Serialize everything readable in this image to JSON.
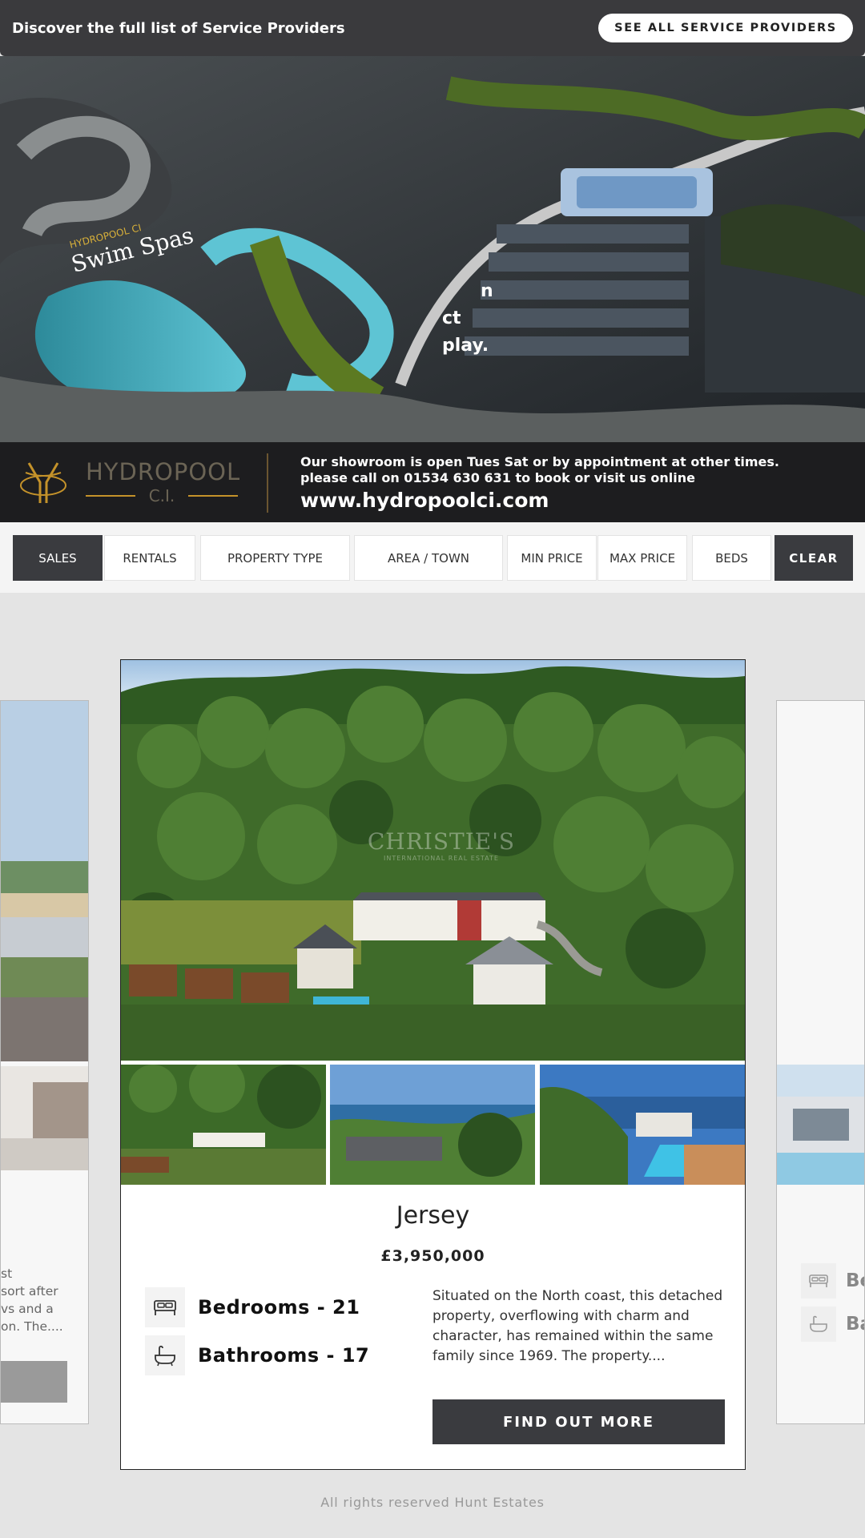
{
  "topbar": {
    "text": "Discover the full list of Service Providers",
    "button": "SEE ALL SERVICE PROVIDERS"
  },
  "ad": {
    "overlay_brand_small": "HYDROPOOL CI",
    "overlay_brand": "Swim Spas",
    "overlay_partial": [
      "n",
      "ct",
      "play."
    ],
    "brand": "HYDROPOOL",
    "brand_sub": "C.I.",
    "info_line1": "Our showroom is open Tues Sat or by appointment at other times.",
    "info_line2": "please call on 01534 630 631 to book or visit us online",
    "url": "www.hydropoolci.com",
    "accent_color": "#c4922a"
  },
  "filters": {
    "items": [
      {
        "label": "SALES"
      },
      {
        "label": "RENTALS"
      },
      {
        "label": "PROPERTY TYPE"
      },
      {
        "label": "AREA / TOWN"
      },
      {
        "label": "MIN PRICE"
      },
      {
        "label": "MAX PRICE"
      },
      {
        "label": "BEDS"
      },
      {
        "label": "CLEAR"
      }
    ],
    "active": "SALES"
  },
  "left_card": {
    "desc_fragments": [
      "st",
      "sort after",
      "vs and a",
      "on. The...."
    ]
  },
  "property": {
    "watermark": "CHRISTIE'S",
    "watermark_sub": "INTERNATIONAL REAL ESTATE",
    "title": "Jersey",
    "price": "£3,950,000",
    "bedrooms": "Bedrooms - 21",
    "bathrooms": "Bathrooms - 17",
    "description": "Situated on the North coast, this detached property, overflowing with charm and character, has remained within the same family since 1969. The property....",
    "button": "FIND OUT MORE"
  },
  "right_card": {
    "bed_partial": "Be",
    "bath_partial": "Ba"
  },
  "footer": {
    "text": "All rights reserved Hunt Estates"
  }
}
